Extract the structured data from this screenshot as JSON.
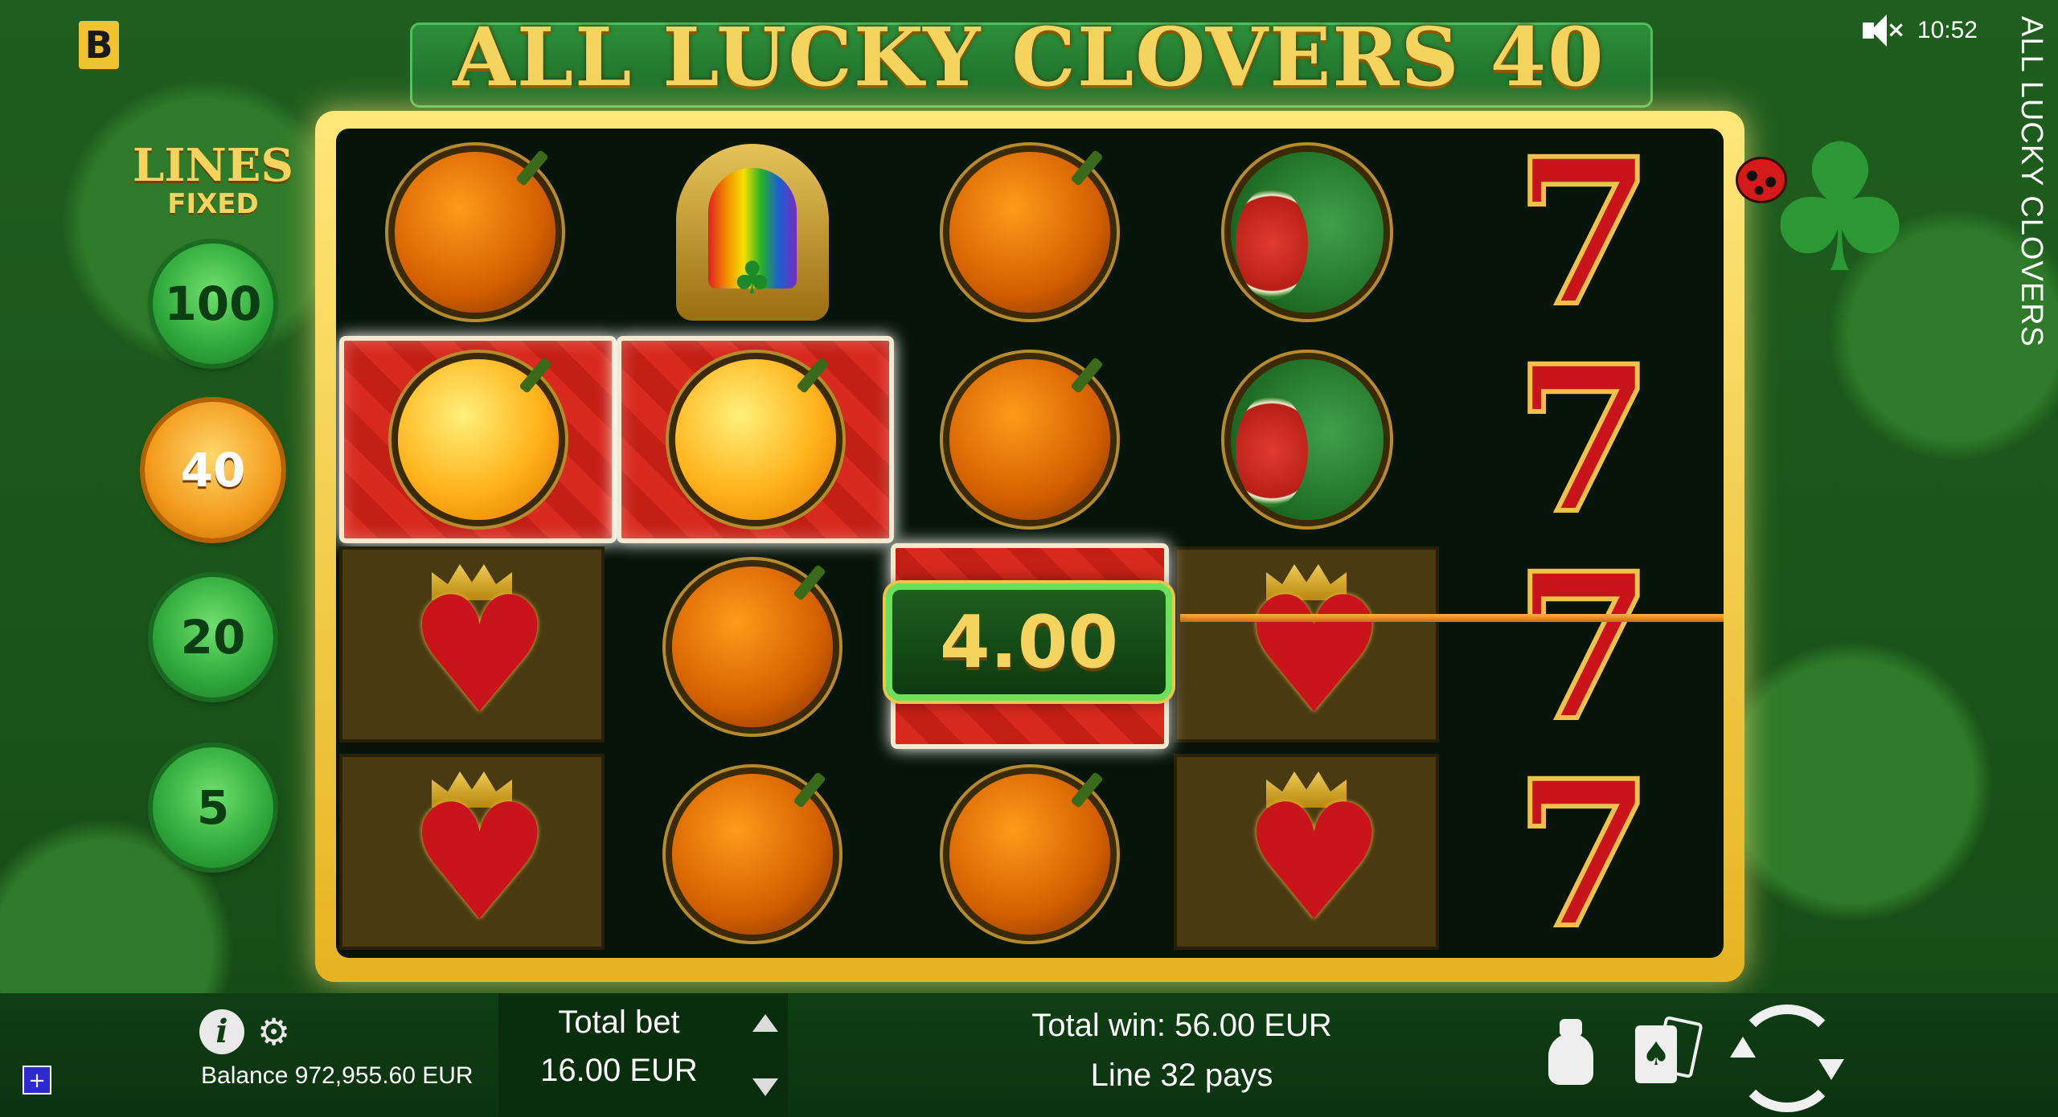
{
  "header": {
    "logo_letter": "B",
    "title": "ALL LUCKY CLOVERS 40",
    "time": "10:52",
    "side_title": "ALL LUCKY CLOVERS",
    "sound_state": "muted"
  },
  "lines_panel": {
    "label": "LINES",
    "sublabel": "FIXED",
    "options": [
      "100",
      "40",
      "20",
      "5"
    ],
    "selected": "40"
  },
  "reels": {
    "columns": 5,
    "rows": 4,
    "symbols": [
      [
        "orange",
        "horseshoe",
        "orange",
        "watermelon",
        "seven"
      ],
      [
        "orange",
        "orange",
        "orange",
        "watermelon",
        "seven"
      ],
      [
        "heart",
        "orange",
        "orange",
        "heart",
        "seven"
      ],
      [
        "heart",
        "orange",
        "orange",
        "heart",
        "seven"
      ]
    ],
    "win_amount": "4.00",
    "seven_glyph": "7",
    "heart_glyph": "♥",
    "clover_glyph": "♣"
  },
  "footer": {
    "info_glyph": "i",
    "settings_glyph": "⚙",
    "plus_glyph": "+",
    "balance": "Balance 972,955.60 EUR",
    "total_bet_label": "Total bet",
    "total_bet_value": "16.00 EUR",
    "total_win": "Total win: 56.00 EUR",
    "line_pays": "Line 32 pays",
    "card_glyph": "♠"
  },
  "icons": {
    "settings": "gear-icon",
    "info": "info-icon",
    "paytable": "money-bag-icon",
    "gamble": "playing-cards-icon",
    "spin": "spin-icon"
  },
  "colors": {
    "background": "#1f5e1f",
    "accent_gold": "#f4d35e",
    "win_red": "#d82a1e",
    "active_line": "#f39a1c"
  }
}
